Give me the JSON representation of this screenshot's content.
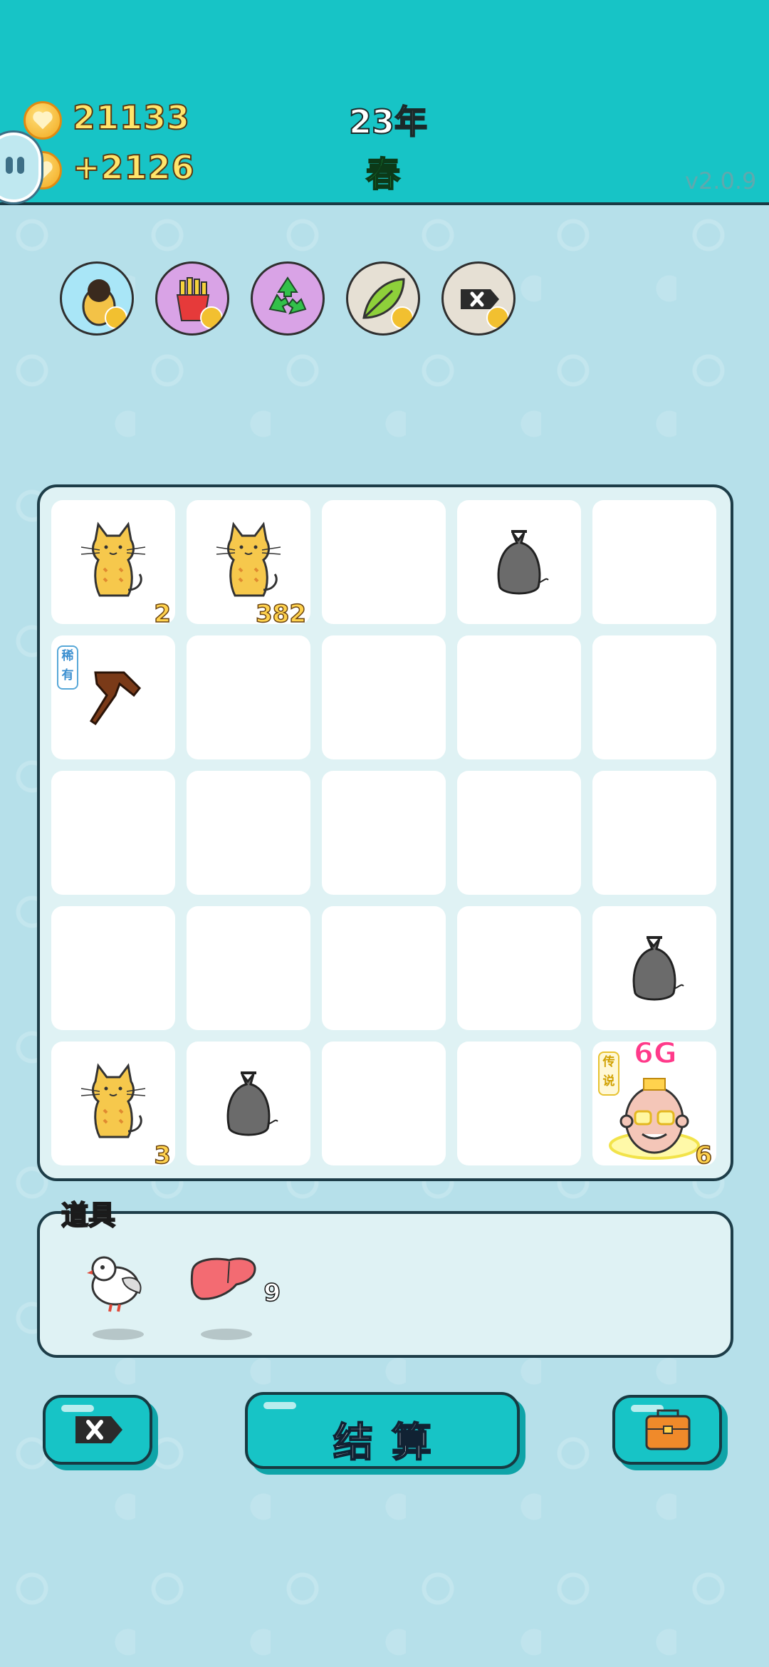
{
  "header": {
    "coins": "21133",
    "income": "+2126",
    "year": "23年",
    "season": "春",
    "version": "v2.0.9"
  },
  "top_buttons": [
    {
      "icon": "cat-plus-icon"
    },
    {
      "icon": "fries-icon"
    },
    {
      "icon": "recycle-icon"
    },
    {
      "icon": "leaf-icon"
    },
    {
      "icon": "delete-tag-icon"
    }
  ],
  "board": {
    "rows": 5,
    "cols": 5,
    "cells": [
      {
        "item": "cat",
        "count": "2"
      },
      {
        "item": "cat",
        "count": "382"
      },
      {
        "item": ""
      },
      {
        "item": "garbage-bag"
      },
      {
        "item": ""
      },
      {
        "item": "hand",
        "tag": "稀有"
      },
      {
        "item": ""
      },
      {
        "item": ""
      },
      {
        "item": ""
      },
      {
        "item": ""
      },
      {
        "item": ""
      },
      {
        "item": ""
      },
      {
        "item": ""
      },
      {
        "item": ""
      },
      {
        "item": ""
      },
      {
        "item": ""
      },
      {
        "item": ""
      },
      {
        "item": ""
      },
      {
        "item": ""
      },
      {
        "item": "garbage-bag"
      },
      {
        "item": "cat",
        "count": "3"
      },
      {
        "item": "garbage-bag"
      },
      {
        "item": ""
      },
      {
        "item": ""
      },
      {
        "item": "old-man",
        "tag": "传说",
        "badge": "6G",
        "count": "6"
      }
    ]
  },
  "inventory": {
    "label": "道具",
    "items": [
      {
        "icon": "dove-icon"
      },
      {
        "icon": "liver-icon",
        "count": "9"
      }
    ]
  },
  "actions": {
    "settle_label": "结算"
  },
  "colors": {
    "header": "#17c4c6",
    "background": "#b6e0ea",
    "button": "#17c4c6"
  }
}
